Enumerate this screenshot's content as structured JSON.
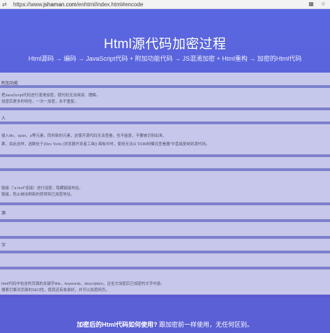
{
  "browser": {
    "url": "https://www.jshaman.com/en/html/index.html#encode",
    "url_prefix": "https://www.",
    "url_domain": "jshaman.com",
    "url_path": "/enhtml/index.html#encode"
  },
  "hero": {
    "title": "Html源代码加密过程",
    "steps": "Html源码 → 编码 → JavaScript代码 + 附加功能代码 → JS混淆加密 + Html重构 → 加密的Html代码"
  },
  "panel": {
    "section1_label": "附加功能",
    "section1_text1": "把JavaScript代码进行混淆加密，使代码无法阅读、理解。",
    "section1_text2": "加密后更多的特性，一次一加密，永不重复。",
    "section2_label": "入",
    "section2_text1": "插入div、span、p等元素，同时新的元素，这使开源代码无法查看，也不能复，不要被识别出来。",
    "section2_text2": "果，如此这样，函数处于(Dev Tools (浏览器开发者工具)) 面板中时，使用无法从“DOM树模式查看器”中直接复制到源代码。",
    "section3_label": "",
    "section3_text1": "链接（“a href”连接）进行加密，隐藏链接地址。",
    "section3_text2": "链接，防止被动刷新的获得到已加密地址。",
    "section4_label": "源",
    "section5_label": "字",
    "section6_text1": "html代码中包含的页面的关键字title、keywords、description，且全文加密后已加密的文字内容。",
    "section6_text2": "搜索引擎对页面的SEO性，使其还有收录好，并可以加密网页。"
  },
  "bottom": {
    "question_bold": "加密后的Html代码如何使用?",
    "answer": "跟加密前一样使用，无任何区别。"
  }
}
